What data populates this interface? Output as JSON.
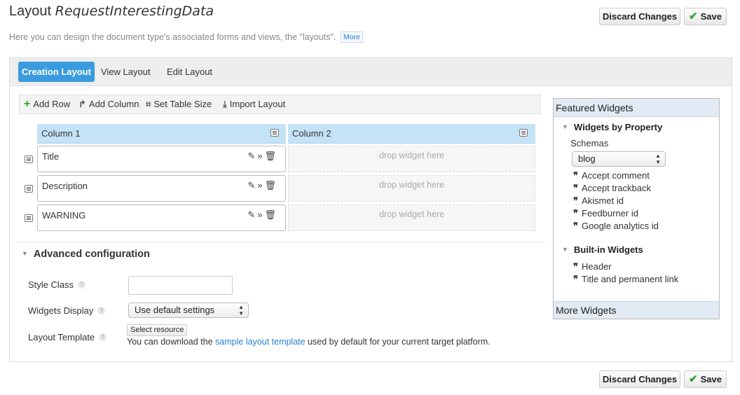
{
  "header": {
    "title_prefix": "Layout",
    "title_name": "RequestInterestingData",
    "subtitle": "Here you can design the document type's associated forms and views, the \"layouts\".",
    "more_label": "More"
  },
  "actions": {
    "discard_label": "Discard Changes",
    "save_label": "Save"
  },
  "tabs": [
    {
      "label": "Creation Layout",
      "active": true
    },
    {
      "label": "View Layout",
      "active": false
    },
    {
      "label": "Edit Layout",
      "active": false
    }
  ],
  "toolbar": {
    "add_row": "Add Row",
    "add_column": "Add Column",
    "set_table_size": "Set Table Size",
    "import_layout": "Import Layout"
  },
  "columns": [
    "Column 1",
    "Column 2"
  ],
  "rows": [
    {
      "widget": "Title",
      "drop": "drop widget here"
    },
    {
      "widget": "Description",
      "drop": "drop widget here"
    },
    {
      "widget": "WARNING",
      "drop": "drop widget here"
    }
  ],
  "advanced": {
    "title": "Advanced configuration",
    "style_class_label": "Style Class",
    "style_class_value": "",
    "widgets_display_label": "Widgets Display",
    "widgets_display_value": "Use default settings",
    "layout_template_label": "Layout Template",
    "select_resource_label": "Select resource",
    "hint_before": "You can download the",
    "hint_link": "sample layout template",
    "hint_after": "used by default for your current target platform."
  },
  "sidebar": {
    "title": "Featured Widgets",
    "by_property_title": "Widgets by Property",
    "schemas_label": "Schemas",
    "schema_value": "blog",
    "property_items": [
      "Accept comment",
      "Accept trackback",
      "Akismet id",
      "Feedburner id",
      "Google analytics id"
    ],
    "builtin_title": "Built-in Widgets",
    "builtin_items": [
      "Header",
      "Title and permanent link"
    ],
    "footer": "More Widgets"
  },
  "colors": {
    "accent": "#3a9be0",
    "column_header": "#c5e3f6",
    "save_check": "#2da62d",
    "link": "#2a7fd0"
  }
}
